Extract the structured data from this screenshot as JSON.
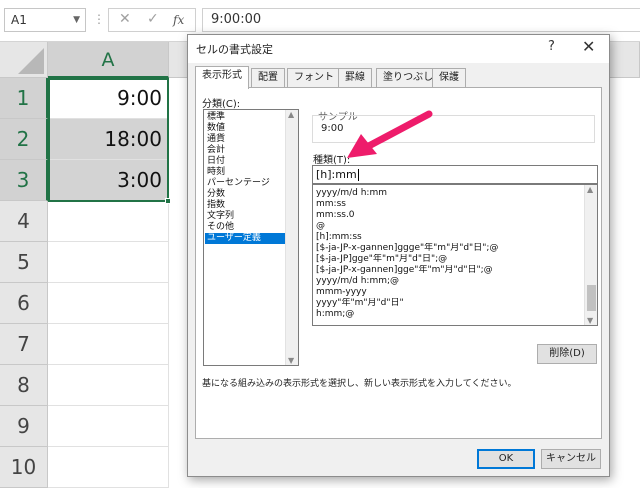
{
  "formula_bar": {
    "name_box": "A1",
    "cancel_icon": "✕",
    "enter_icon": "✓",
    "function_icon": "fx",
    "value": "9:00:00"
  },
  "sheet": {
    "columns": [
      "A"
    ],
    "rows": [
      "1",
      "2",
      "3",
      "4",
      "5",
      "6",
      "7",
      "8",
      "9",
      "10"
    ],
    "cells": [
      "9:00",
      "18:00",
      "3:00"
    ]
  },
  "dialog": {
    "title": "セルの書式設定",
    "help_label": "?",
    "close_label": "✕",
    "tabs": [
      "表示形式",
      "配置",
      "フォント",
      "罫線",
      "塗りつぶし",
      "保護"
    ],
    "category_label": "分類(C):",
    "categories": [
      "標準",
      "数値",
      "通貨",
      "会計",
      "日付",
      "時刻",
      "パーセンテージ",
      "分数",
      "指数",
      "文字列",
      "その他",
      "ユーザー定義"
    ],
    "selected_category": "ユーザー定義",
    "sample_label": "サンプル",
    "sample_value": "9:00",
    "type_label": "種類(T):",
    "type_value": "[h]:mm",
    "format_list": [
      "yyyy/m/d h:mm",
      "mm:ss",
      "mm:ss.0",
      "@",
      "[h]:mm:ss",
      "[$-ja-JP-x-gannen]ggge\"年\"m\"月\"d\"日\";@",
      "[$-ja-JP]gge\"年\"m\"月\"d\"日\";@",
      "[$-ja-JP-x-gannen]gge\"年\"m\"月\"d\"日\";@",
      "yyyy/m/d h:mm;@",
      "mmm-yyyy",
      "yyyy\"年\"m\"月\"d\"日\"",
      "h:mm;@"
    ],
    "delete_button": "削除(D)",
    "description": "基になる組み込みの表示形式を選択し、新しい表示形式を入力してください。",
    "ok_button": "OK",
    "cancel_button": "キャンセル"
  },
  "colors": {
    "excel_green": "#217346",
    "selection_blue": "#0078d7",
    "annotation_arrow": "#ee1c6b"
  }
}
